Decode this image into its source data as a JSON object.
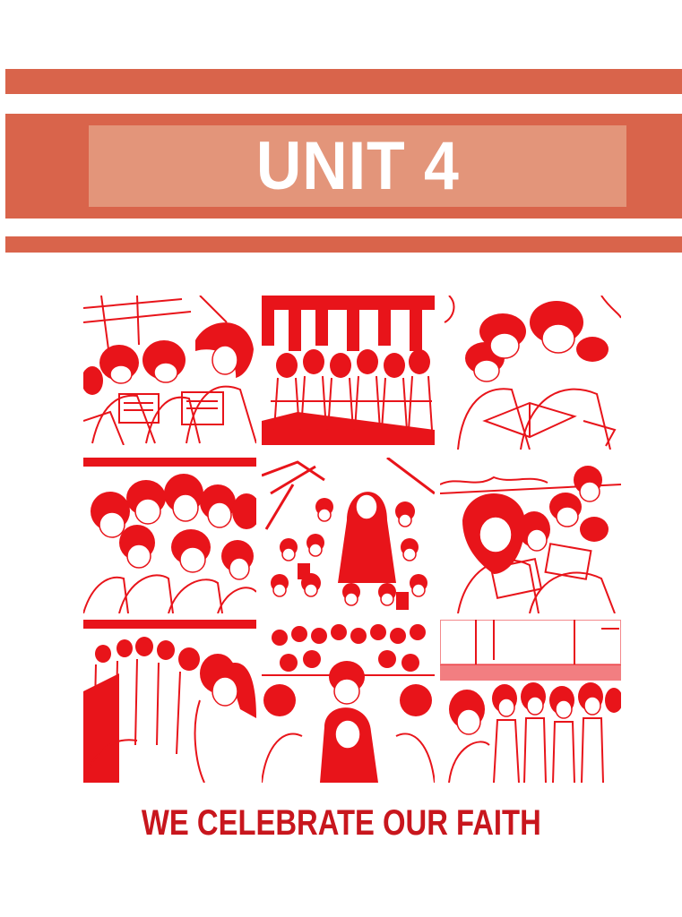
{
  "header": {
    "unit_title": "UNIT 4"
  },
  "footer": {
    "subtitle": "WE CELEBRATE OUR FAITH"
  },
  "colors": {
    "stripe": "#d9644b",
    "title_box": "#e3957a",
    "title_text": "#ffffff",
    "illustration_ink": "#e8141a",
    "subtitle_text": "#c8161d"
  },
  "illustrations": [
    "students-reading-handouts",
    "students-standing-in-row",
    "boys-reading-book-together",
    "group-of-smiling-teens",
    "children-with-religious-figure",
    "girls-reading-papers",
    "line-of-students-profile",
    "seated-audience-in-church",
    "crowd-of-teens-standing"
  ]
}
